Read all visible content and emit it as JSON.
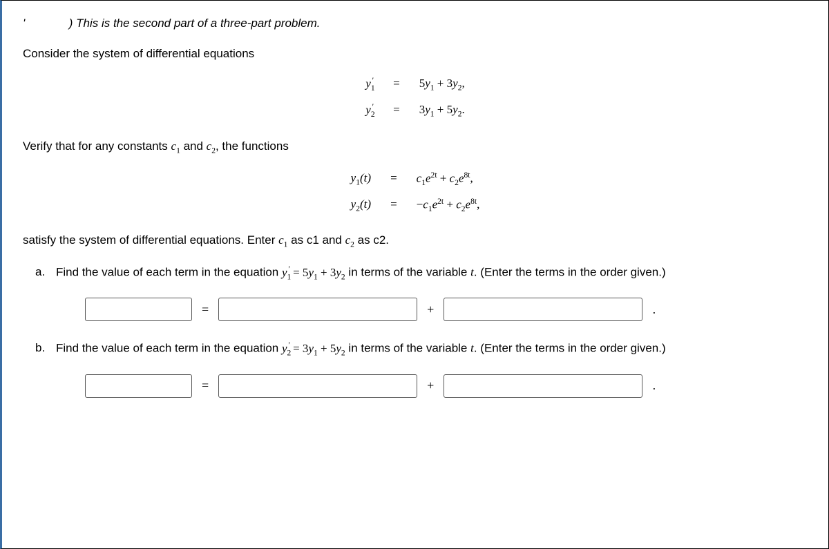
{
  "intro_part1": "'",
  "intro_part2": ") ",
  "intro_italic": "This is the second part of a three-part problem.",
  "consider": "Consider the system of differential equations",
  "system": {
    "row1": {
      "lhs": "y₁′",
      "rhs": "5y₁ + 3y₂,"
    },
    "row2": {
      "lhs": "y₂′",
      "rhs": "3y₁ + 5y₂."
    }
  },
  "verify_prefix": "Verify that for any constants ",
  "c1": "c₁",
  "and": " and ",
  "c2": "c₂",
  "verify_suffix": ", the functions",
  "functions": {
    "row1": {
      "lhs": "y₁(t)",
      "rhs": "c₁e²ᵗ + c₂e⁸ᵗ,"
    },
    "row2": {
      "lhs": "y₂(t)",
      "rhs": "−c₁e²ᵗ + c₂e⁸ᵗ,"
    }
  },
  "satisfy_a": "satisfy the system of differential equations. Enter ",
  "satisfy_b": " as c1 and ",
  "satisfy_c": " as c2.",
  "qa": {
    "letter": "a.",
    "pre": "Find the value of each term in the equation ",
    "eq": "y₁′ = 5y₁ + 3y₂",
    "mid": " in terms of the variable ",
    "t": "t",
    "post": ". (Enter the terms in the order given.)"
  },
  "qb": {
    "letter": "b.",
    "pre": "Find the value of each term in the equation ",
    "eq": "y₂′ = 3y₁ + 5y₂",
    "mid": " in terms of the variable ",
    "t": "t",
    "post": ". (Enter the terms in the order given.)"
  },
  "ops": {
    "equals": "=",
    "plus": "+",
    "period": "."
  },
  "ph": ""
}
